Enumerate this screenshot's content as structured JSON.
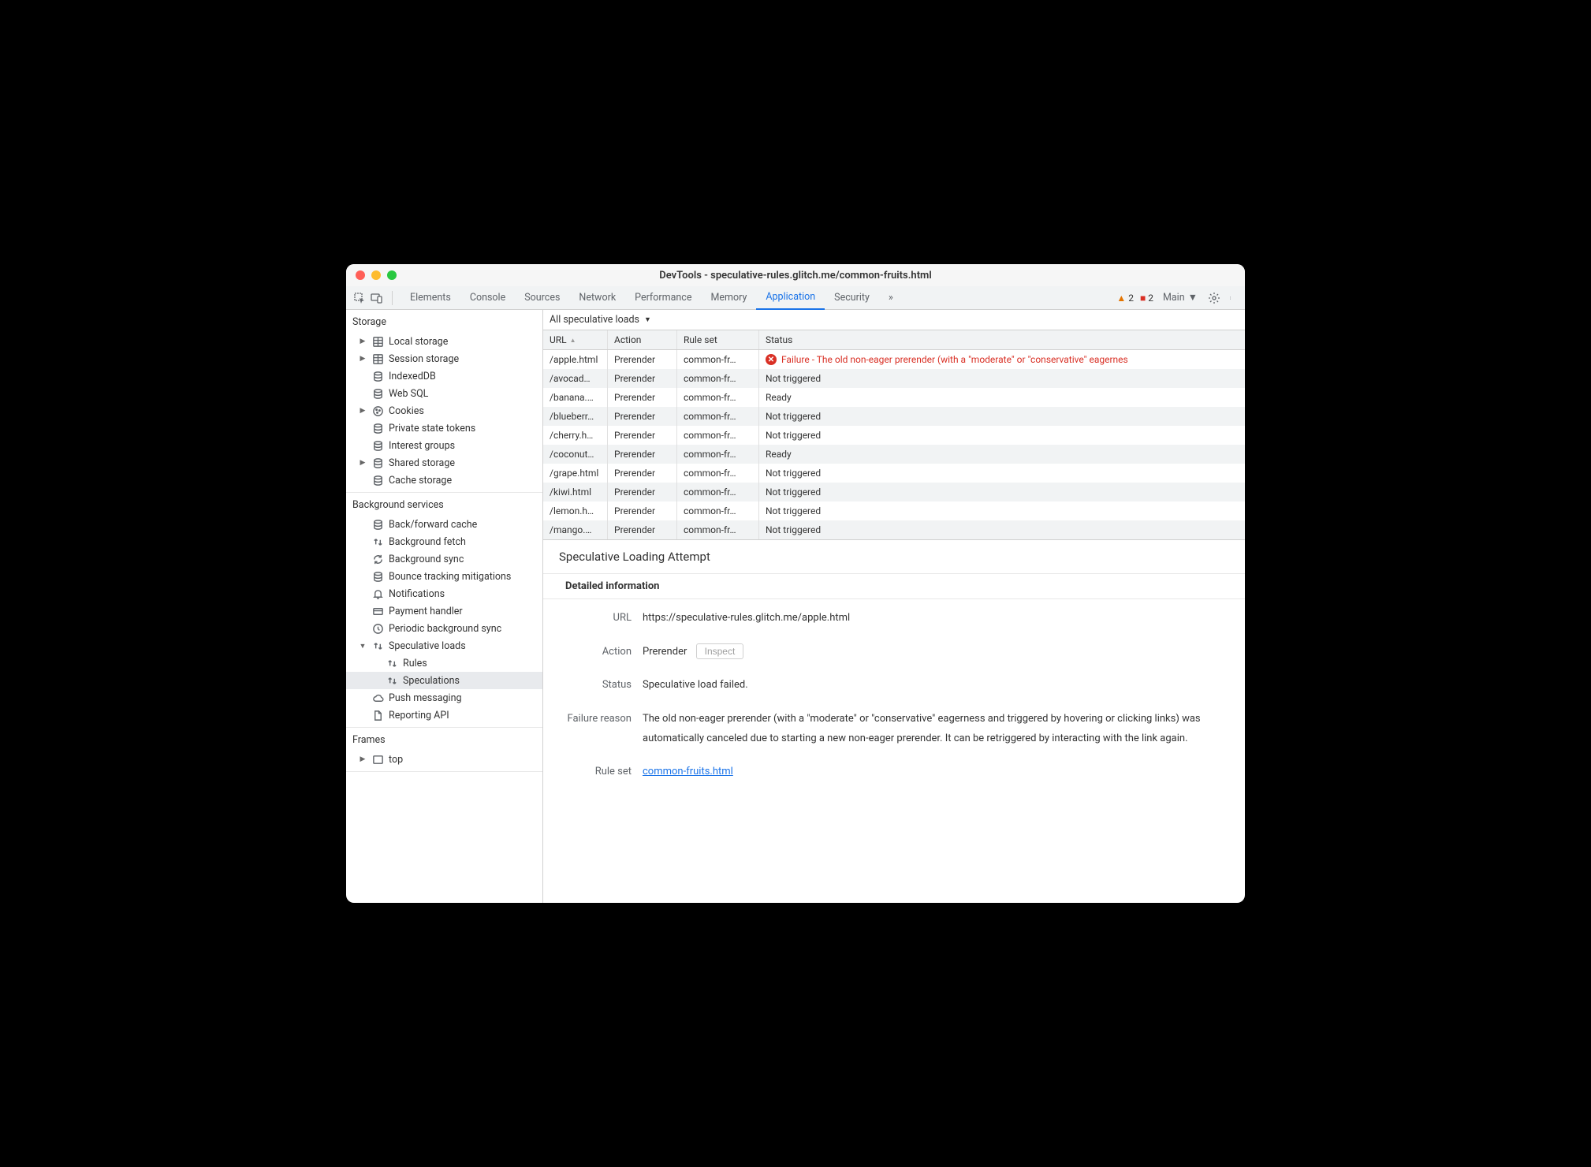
{
  "window": {
    "title": "DevTools - speculative-rules.glitch.me/common-fruits.html"
  },
  "tabs": {
    "items": [
      "Elements",
      "Console",
      "Sources",
      "Network",
      "Performance",
      "Memory",
      "Application",
      "Security"
    ],
    "active": "Application",
    "overflow": "»"
  },
  "warnings": {
    "triangle": "2",
    "square": "2"
  },
  "frame_selector": {
    "label": "Main"
  },
  "sidebar": {
    "storage": {
      "heading": "Storage",
      "items": [
        {
          "label": "Local storage",
          "icon": "db-grid",
          "expandable": true
        },
        {
          "label": "Session storage",
          "icon": "db-grid",
          "expandable": true
        },
        {
          "label": "IndexedDB",
          "icon": "db"
        },
        {
          "label": "Web SQL",
          "icon": "db"
        },
        {
          "label": "Cookies",
          "icon": "cookie",
          "expandable": true
        },
        {
          "label": "Private state tokens",
          "icon": "db"
        },
        {
          "label": "Interest groups",
          "icon": "db"
        },
        {
          "label": "Shared storage",
          "icon": "db",
          "expandable": true
        },
        {
          "label": "Cache storage",
          "icon": "db"
        }
      ]
    },
    "bg": {
      "heading": "Background services",
      "items": [
        {
          "label": "Back/forward cache",
          "icon": "db"
        },
        {
          "label": "Background fetch",
          "icon": "updown"
        },
        {
          "label": "Background sync",
          "icon": "sync"
        },
        {
          "label": "Bounce tracking mitigations",
          "icon": "db"
        },
        {
          "label": "Notifications",
          "icon": "bell"
        },
        {
          "label": "Payment handler",
          "icon": "card"
        },
        {
          "label": "Periodic background sync",
          "icon": "clock"
        },
        {
          "label": "Speculative loads",
          "icon": "updown",
          "expandable": true,
          "expanded": true
        },
        {
          "label": "Rules",
          "icon": "updown",
          "indent": 2
        },
        {
          "label": "Speculations",
          "icon": "updown",
          "indent": 2,
          "selected": true
        },
        {
          "label": "Push messaging",
          "icon": "cloud"
        },
        {
          "label": "Reporting API",
          "icon": "file"
        }
      ]
    },
    "frames": {
      "heading": "Frames",
      "items": [
        {
          "label": "top",
          "icon": "frame",
          "expandable": true
        }
      ]
    }
  },
  "filter": {
    "label": "All speculative loads"
  },
  "table": {
    "headers": {
      "url": "URL",
      "action": "Action",
      "ruleset": "Rule set",
      "status": "Status"
    },
    "rows": [
      {
        "url": "/apple.html",
        "action": "Prerender",
        "ruleset": "common-fr…",
        "status": "Failure - The old non-eager prerender (with a \"moderate\" or \"conservative\" eagernes",
        "error": true
      },
      {
        "url": "/avocad…",
        "action": "Prerender",
        "ruleset": "common-fr…",
        "status": "Not triggered"
      },
      {
        "url": "/banana.…",
        "action": "Prerender",
        "ruleset": "common-fr…",
        "status": "Ready"
      },
      {
        "url": "/blueberr…",
        "action": "Prerender",
        "ruleset": "common-fr…",
        "status": "Not triggered"
      },
      {
        "url": "/cherry.h…",
        "action": "Prerender",
        "ruleset": "common-fr…",
        "status": "Not triggered"
      },
      {
        "url": "/coconut…",
        "action": "Prerender",
        "ruleset": "common-fr…",
        "status": "Ready"
      },
      {
        "url": "/grape.html",
        "action": "Prerender",
        "ruleset": "common-fr…",
        "status": "Not triggered"
      },
      {
        "url": "/kiwi.html",
        "action": "Prerender",
        "ruleset": "common-fr…",
        "status": "Not triggered"
      },
      {
        "url": "/lemon.h…",
        "action": "Prerender",
        "ruleset": "common-fr…",
        "status": "Not triggered"
      },
      {
        "url": "/mango.…",
        "action": "Prerender",
        "ruleset": "common-fr…",
        "status": "Not triggered"
      }
    ]
  },
  "detail": {
    "title": "Speculative Loading Attempt",
    "subtitle": "Detailed information",
    "url_label": "URL",
    "url_value": "https://speculative-rules.glitch.me/apple.html",
    "action_label": "Action",
    "action_value": "Prerender",
    "inspect_label": "Inspect",
    "status_label": "Status",
    "status_value": "Speculative load failed.",
    "failure_label": "Failure reason",
    "failure_value": "The old non-eager prerender (with a \"moderate\" or \"conservative\" eagerness and triggered by hovering or clicking links) was automatically canceled due to starting a new non-eager prerender. It can be retriggered by interacting with the link again.",
    "ruleset_label": "Rule set",
    "ruleset_value": "common-fruits.html"
  }
}
